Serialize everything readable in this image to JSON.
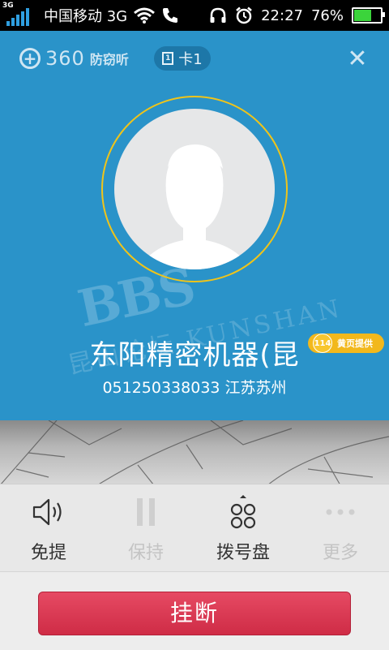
{
  "status_bar": {
    "network_tag": "3G",
    "carrier": "中国移动 3G",
    "time": "22:27",
    "battery_percent": "76%",
    "battery_level": 0.76
  },
  "app_bar": {
    "brand_number": "360",
    "brand_text": "防窃听",
    "sim_label": "卡1",
    "sim_icon_text": "1",
    "close_symbol": "✕"
  },
  "caller": {
    "name": "东阳精密机器(昆",
    "number_location": "051250338033 江苏苏州",
    "yellow_pages_badge": "黄页提供",
    "yellow_pages_logo": "114"
  },
  "watermark": {
    "main": "BBS",
    "sub": "昆山论坛 KUNSHAN"
  },
  "controls": [
    {
      "label": "免提",
      "icon": "speaker-icon",
      "enabled": true
    },
    {
      "label": "保持",
      "icon": "pause-icon",
      "enabled": false
    },
    {
      "label": "拨号盘",
      "icon": "dialpad-icon",
      "enabled": true
    },
    {
      "label": "更多",
      "icon": "more-icon",
      "enabled": false
    }
  ],
  "hangup_label": "挂断",
  "colors": {
    "background": "#2a93c9",
    "ring": "#f0c419",
    "hangup": "#d9334e",
    "badge": "#f2b81c"
  }
}
